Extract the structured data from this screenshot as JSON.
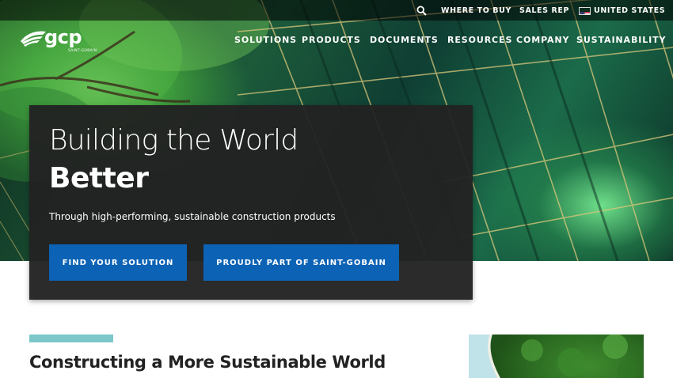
{
  "utility_bar": {
    "search_icon": "search-icon",
    "where_to_buy": "WHERE TO BUY",
    "sales_rep": "SALES REP",
    "country_flag_icon": "us-flag-icon",
    "country": "UNITED STATES"
  },
  "header": {
    "logo_text": "gcp",
    "logo_subtext": "SAINT-GOBAIN",
    "nav": [
      "SOLUTIONS",
      "PRODUCTS",
      "DOCUMENTS",
      "RESOURCES",
      "COMPANY",
      "SUSTAINABILITY"
    ]
  },
  "hero": {
    "title_line1": "Building the World",
    "title_line2": "Better",
    "subtitle": "Through high-performing, sustainable construction products",
    "button_primary": "FIND YOUR SOLUTION",
    "button_secondary": "PROUDLY PART OF SAINT-GOBAIN"
  },
  "section": {
    "title_prefix": "Constructing a More ",
    "title_bold": "Sustainable World"
  },
  "colors": {
    "button_blue": "#0c63b5",
    "accent_teal": "#7cc7c9",
    "card_dark": "#222222"
  }
}
